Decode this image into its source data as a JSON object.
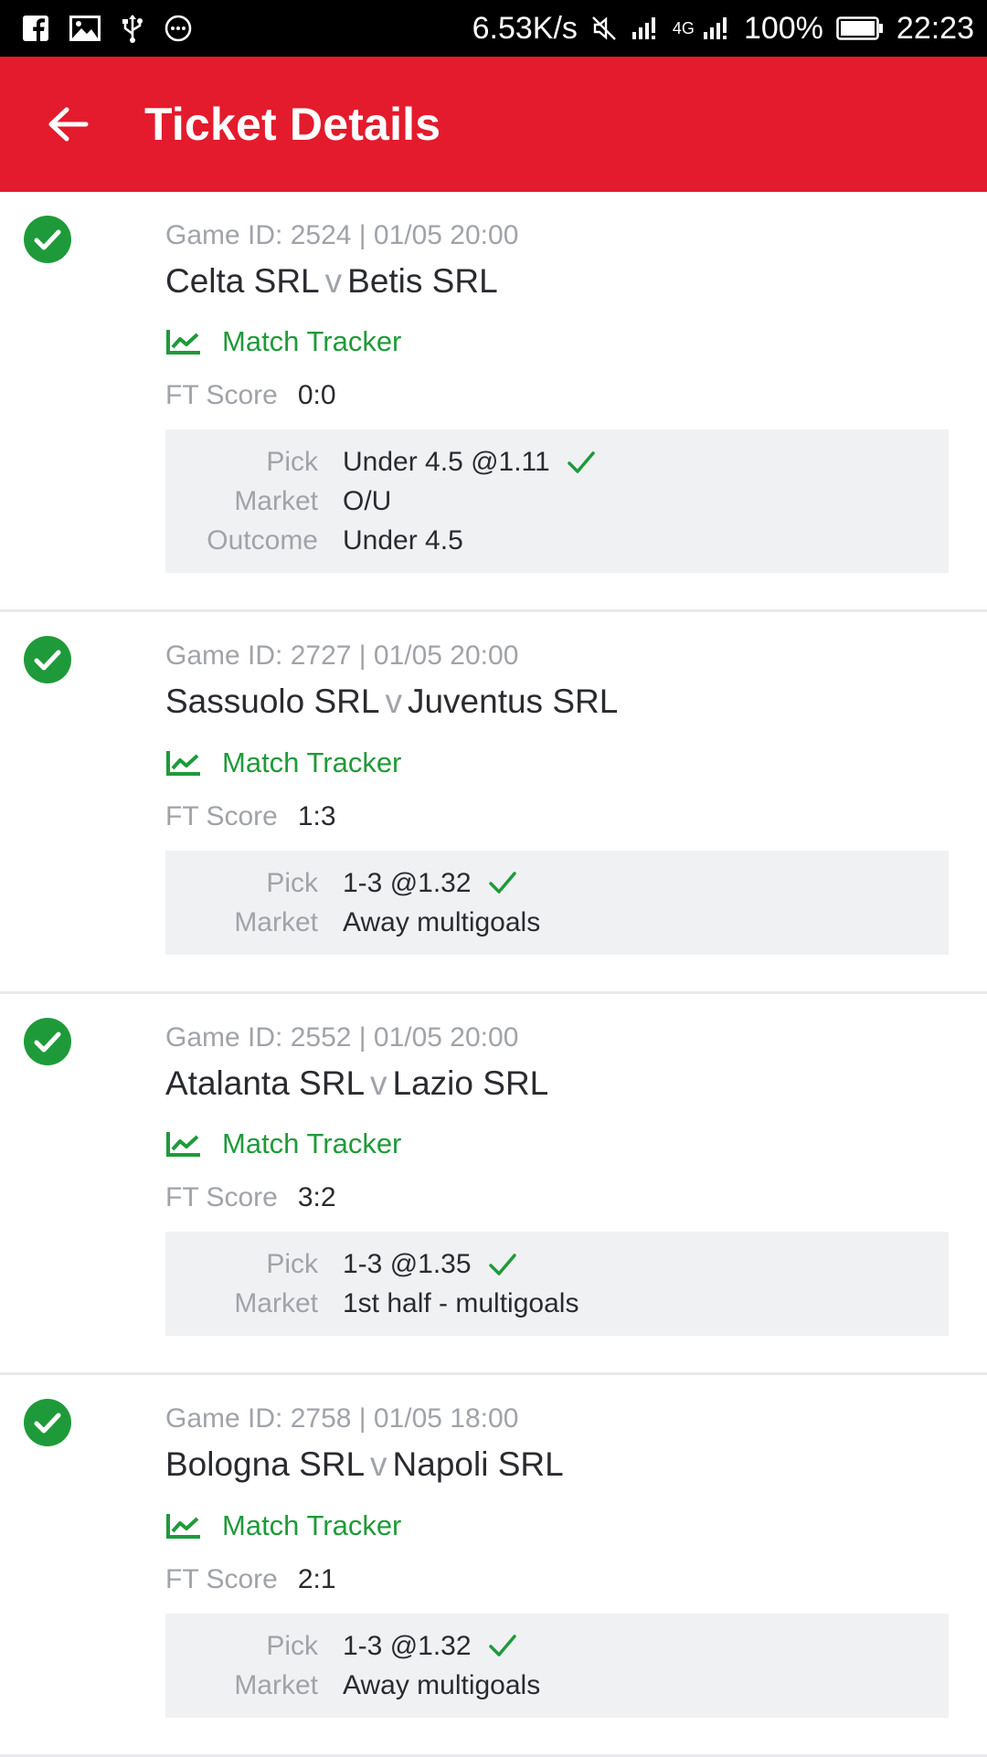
{
  "status_bar": {
    "left_icons": [
      "facebook-icon",
      "image-icon",
      "usb-icon",
      "more-circle-icon"
    ],
    "network_speed": "6.53K/s",
    "network_type": "4G",
    "battery": "100%",
    "time": "22:23"
  },
  "header": {
    "title": "Ticket Details",
    "back_icon": "arrow-left-icon",
    "color": "#e31b2c"
  },
  "colors": {
    "success": "#1f9a3a",
    "muted": "#a0a3a9",
    "text": "#2a2b30",
    "panel": "#f0f1f3"
  },
  "tickets": [
    {
      "game_info": "Game ID: 2524 | 01/05 20:00",
      "home": "Celta SRL",
      "vs": "v",
      "away": "Betis SRL",
      "tracker_label": "Match Tracker",
      "ft_label": "FT Score",
      "ft_score": "0:0",
      "details": [
        {
          "label": "Pick",
          "value": "Under 4.5 @1.11",
          "check": true
        },
        {
          "label": "Market",
          "value": "O/U",
          "check": false
        },
        {
          "label": "Outcome",
          "value": "Under 4.5",
          "check": false
        }
      ]
    },
    {
      "game_info": "Game ID: 2727 | 01/05 20:00",
      "home": "Sassuolo SRL",
      "vs": "v",
      "away": "Juventus SRL",
      "tracker_label": "Match Tracker",
      "ft_label": "FT Score",
      "ft_score": "1:3",
      "details": [
        {
          "label": "Pick",
          "value": "1-3 @1.32",
          "check": true
        },
        {
          "label": "Market",
          "value": "Away multigoals",
          "check": false
        }
      ]
    },
    {
      "game_info": "Game ID: 2552 | 01/05 20:00",
      "home": "Atalanta SRL",
      "vs": "v",
      "away": "Lazio SRL",
      "tracker_label": "Match Tracker",
      "ft_label": "FT Score",
      "ft_score": "3:2",
      "details": [
        {
          "label": "Pick",
          "value": "1-3 @1.35",
          "check": true
        },
        {
          "label": "Market",
          "value": "1st half - multigoals",
          "check": false
        }
      ]
    },
    {
      "game_info": "Game ID: 2758 | 01/05 18:00",
      "home": "Bologna SRL",
      "vs": "v",
      "away": "Napoli SRL",
      "tracker_label": "Match Tracker",
      "ft_label": "FT Score",
      "ft_score": "2:1",
      "details": [
        {
          "label": "Pick",
          "value": "1-3 @1.32",
          "check": true
        },
        {
          "label": "Market",
          "value": "Away multigoals",
          "check": false
        }
      ]
    }
  ]
}
